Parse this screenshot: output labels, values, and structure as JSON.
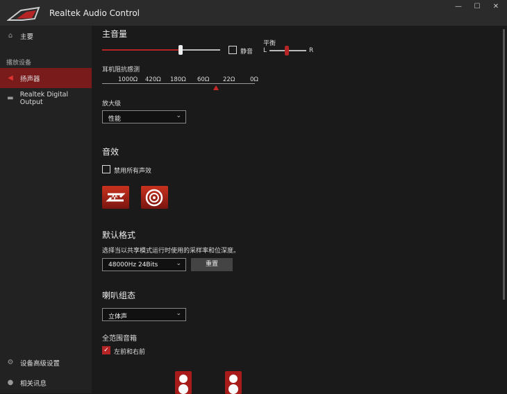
{
  "window": {
    "title": "Realtek Audio Control",
    "minimize": "—",
    "maximize": "☐",
    "close": "✕"
  },
  "sidebar": {
    "home": "主要",
    "section": "播放设备",
    "devices": [
      "扬声器",
      "Realtek Digital Output"
    ],
    "advanced": "设备高级设置",
    "info": "相关讯息"
  },
  "volume": {
    "title": "主音量",
    "mute": "静音",
    "balance": "平衡",
    "left": "L",
    "right": "R",
    "level": 0.67,
    "balance_value": 0.5
  },
  "impedance": {
    "title": "耳机阻抗感测",
    "ticks": [
      "1000Ω",
      "420Ω",
      "180Ω",
      "60Ω",
      "22Ω",
      "0Ω"
    ]
  },
  "amp": {
    "title": "放大级",
    "value": "性能"
  },
  "effects": {
    "title": "音效",
    "disable_all": "禁用所有声效"
  },
  "format": {
    "title": "默认格式",
    "desc": "选择当以共享模式运行时使用的采样率和位深度。",
    "value": "48000Hz 24Bits",
    "reset": "重置"
  },
  "speaker": {
    "title": "喇叭组态",
    "value": "立体声",
    "fullrange": "全范围音箱",
    "front": "左前和右前"
  }
}
